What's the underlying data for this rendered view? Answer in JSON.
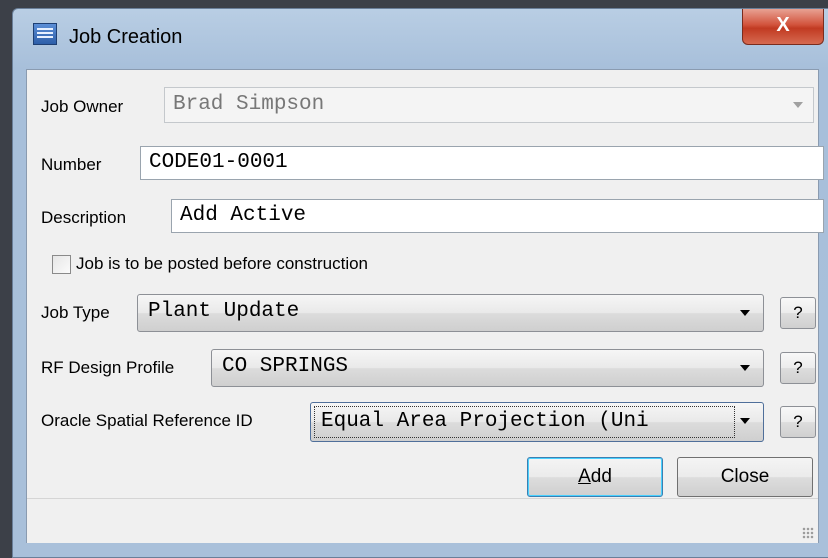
{
  "window": {
    "title": "Job Creation",
    "close_label": "X"
  },
  "form": {
    "job_owner": {
      "label": "Job Owner",
      "value": "Brad Simpson"
    },
    "number": {
      "label": "Number",
      "value": "CODE01-0001"
    },
    "description": {
      "label": "Description",
      "value": "Add Active"
    },
    "posted_checkbox": {
      "label": "Job is to be posted before construction",
      "checked": false
    },
    "job_type": {
      "label": "Job Type",
      "value": "Plant Update",
      "help": "?"
    },
    "rf_design_profile": {
      "label": "RF Design Profile",
      "value": "CO SPRINGS",
      "help": "?"
    },
    "spatial_ref": {
      "label": "Oracle Spatial Reference ID",
      "value": "Equal Area Projection (Uni",
      "help": "?"
    }
  },
  "buttons": {
    "add_mnemonic": "A",
    "add_rest": "dd",
    "close": "Close"
  },
  "icons": {
    "app": "window-app-icon",
    "dropdown": "chevron-down-icon",
    "grip": "resize-grip-icon"
  }
}
